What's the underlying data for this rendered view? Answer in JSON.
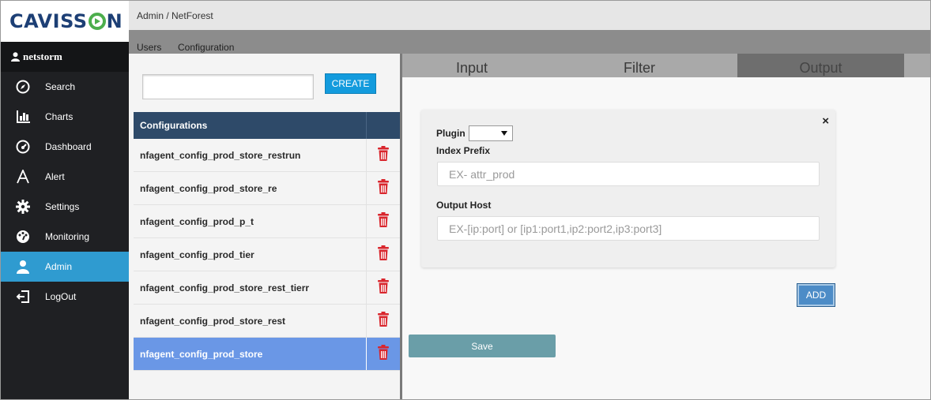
{
  "brand": {
    "logo_text_pre": "CAVISS",
    "logo_text_post": "N"
  },
  "user": {
    "name": "netstorm"
  },
  "sidebar": {
    "items": [
      {
        "label": "Search",
        "icon": "compass-icon"
      },
      {
        "label": "Charts",
        "icon": "bar-chart-icon"
      },
      {
        "label": "Dashboard",
        "icon": "dashboard-icon"
      },
      {
        "label": "Alert",
        "icon": "alert-icon"
      },
      {
        "label": "Settings",
        "icon": "gear-icon"
      },
      {
        "label": "Monitoring",
        "icon": "monitoring-icon"
      },
      {
        "label": "Admin",
        "icon": "user-icon",
        "active": true
      },
      {
        "label": "LogOut",
        "icon": "logout-icon"
      }
    ]
  },
  "breadcrumb": "Admin / NetForest",
  "tabs": [
    {
      "label": "Users"
    },
    {
      "label": "Configuration"
    }
  ],
  "left": {
    "search_value": "",
    "create_label": "CREATE",
    "table_header": "Configurations",
    "rows": [
      {
        "name": "nfagent_config_prod_store_restrun"
      },
      {
        "name": "nfagent_config_prod_store_re"
      },
      {
        "name": "nfagent_config_prod_p_t"
      },
      {
        "name": "nfagent_config_prod_tier"
      },
      {
        "name": "nfagent_config_prod_store_rest_tierr"
      },
      {
        "name": "nfagent_config_prod_store_rest"
      },
      {
        "name": "nfagent_config_prod_store",
        "selected": true
      }
    ]
  },
  "right": {
    "sub_tabs": [
      {
        "label": "Input"
      },
      {
        "label": "Filter"
      },
      {
        "label": "Output",
        "active": true
      }
    ],
    "close_label": "×",
    "plugin_label": "Plugin",
    "plugin_value": "",
    "index_prefix_label": "Index Prefix",
    "index_prefix_placeholder": "EX- attr_prod",
    "output_host_label": "Output Host",
    "output_host_placeholder": "EX-[ip:port] or [ip1:port1,ip2:port2,ip3:port3]",
    "add_label": "ADD",
    "save_label": "Save"
  },
  "colors": {
    "sidebar_bg": "#1f2023",
    "active_nav": "#2f9bd0",
    "table_header": "#2e4a69",
    "selected_row": "#6a97e6",
    "delete_icon": "#d9262d",
    "tab_underline": "#d9262d"
  }
}
